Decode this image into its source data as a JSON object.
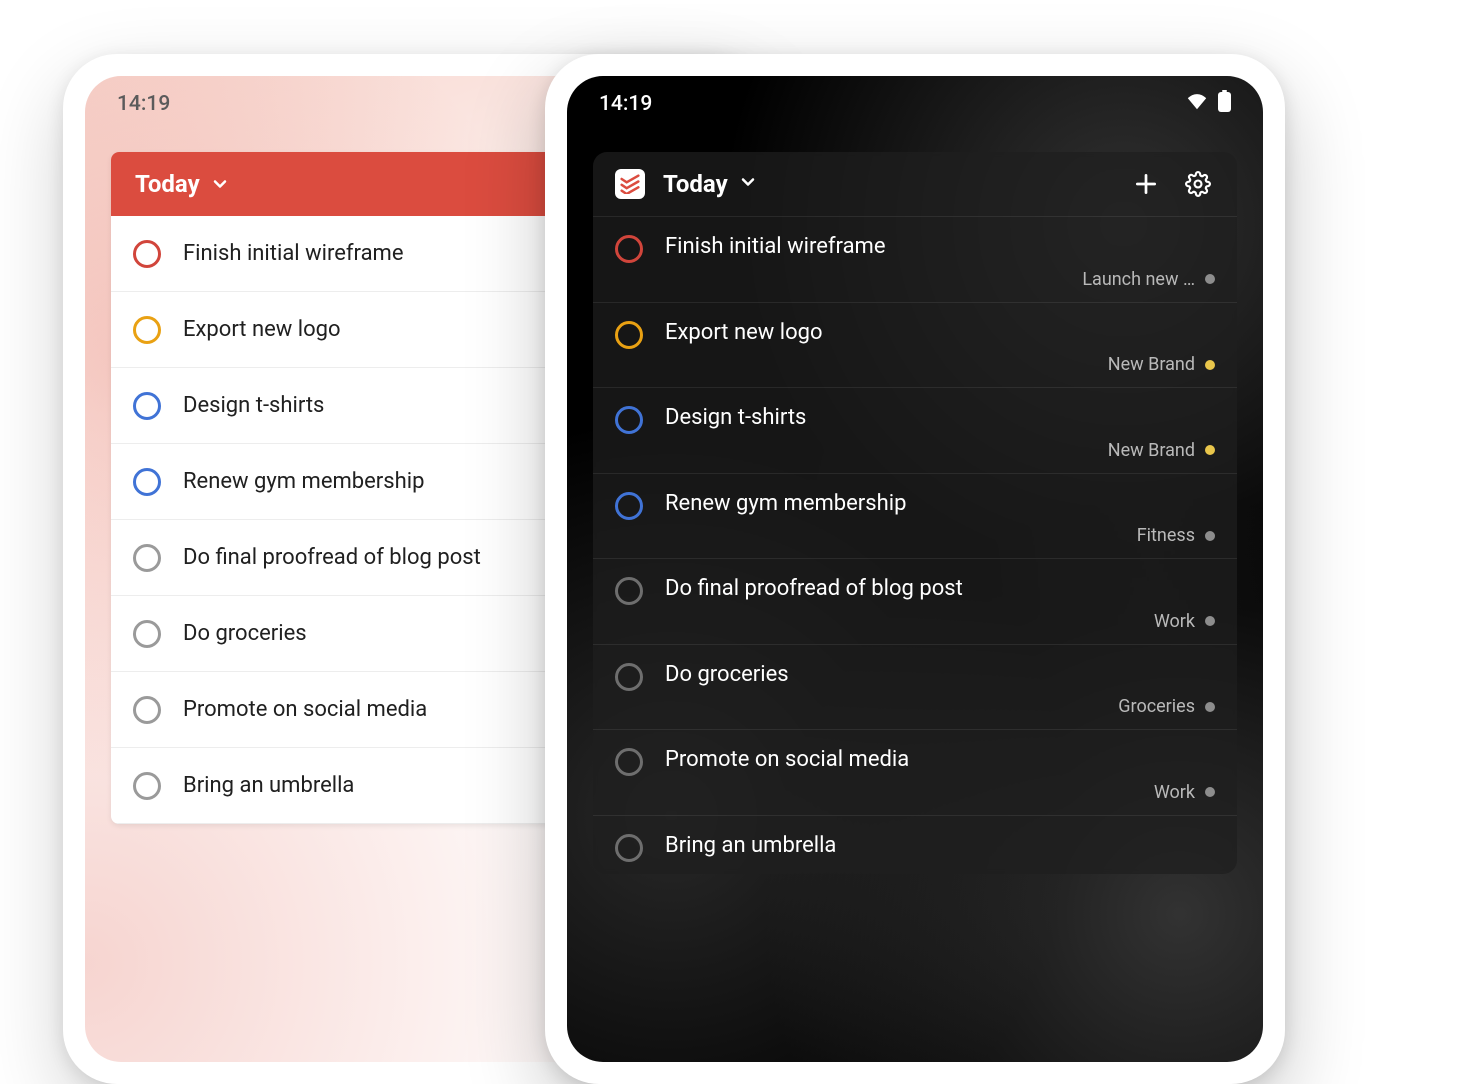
{
  "light": {
    "time": "14:19",
    "header_title": "Today",
    "tasks": [
      {
        "title": "Finish initial wireframe",
        "circle_color": "#d1453b"
      },
      {
        "title": "Export new logo",
        "circle_color": "#e9a113"
      },
      {
        "title": "Design t-shirts",
        "circle_color": "#4073d6"
      },
      {
        "title": "Renew gym membership",
        "circle_color": "#4073d6"
      },
      {
        "title": "Do final proofread of blog post",
        "circle_color": "#9a9a9a"
      },
      {
        "title": "Do groceries",
        "circle_color": "#9a9a9a"
      },
      {
        "title": "Promote on social media",
        "circle_color": "#9a9a9a"
      },
      {
        "title": "Bring an umbrella",
        "circle_color": "#9a9a9a"
      }
    ]
  },
  "dark": {
    "time": "14:19",
    "header_title": "Today",
    "tasks": [
      {
        "title": "Finish initial wireframe",
        "circle_color": "#d1453b",
        "project": "Launch new …",
        "dot_color": "#8d8d8d"
      },
      {
        "title": "Export new logo",
        "circle_color": "#e9a113",
        "project": "New Brand",
        "dot_color": "#e9c64b"
      },
      {
        "title": "Design t-shirts",
        "circle_color": "#4073d6",
        "project": "New Brand",
        "dot_color": "#e9c64b"
      },
      {
        "title": "Renew gym membership",
        "circle_color": "#4073d6",
        "project": "Fitness",
        "dot_color": "#8d8d8d"
      },
      {
        "title": "Do final proofread of blog post",
        "circle_color": "#6e6e6e",
        "project": "Work",
        "dot_color": "#8d8d8d"
      },
      {
        "title": "Do groceries",
        "circle_color": "#6e6e6e",
        "project": "Groceries",
        "dot_color": "#8d8d8d"
      },
      {
        "title": "Promote on social media",
        "circle_color": "#6e6e6e",
        "project": "Work",
        "dot_color": "#8d8d8d"
      },
      {
        "title": "Bring an umbrella",
        "circle_color": "#6e6e6e",
        "project": "",
        "dot_color": "#8d8d8d"
      }
    ]
  }
}
